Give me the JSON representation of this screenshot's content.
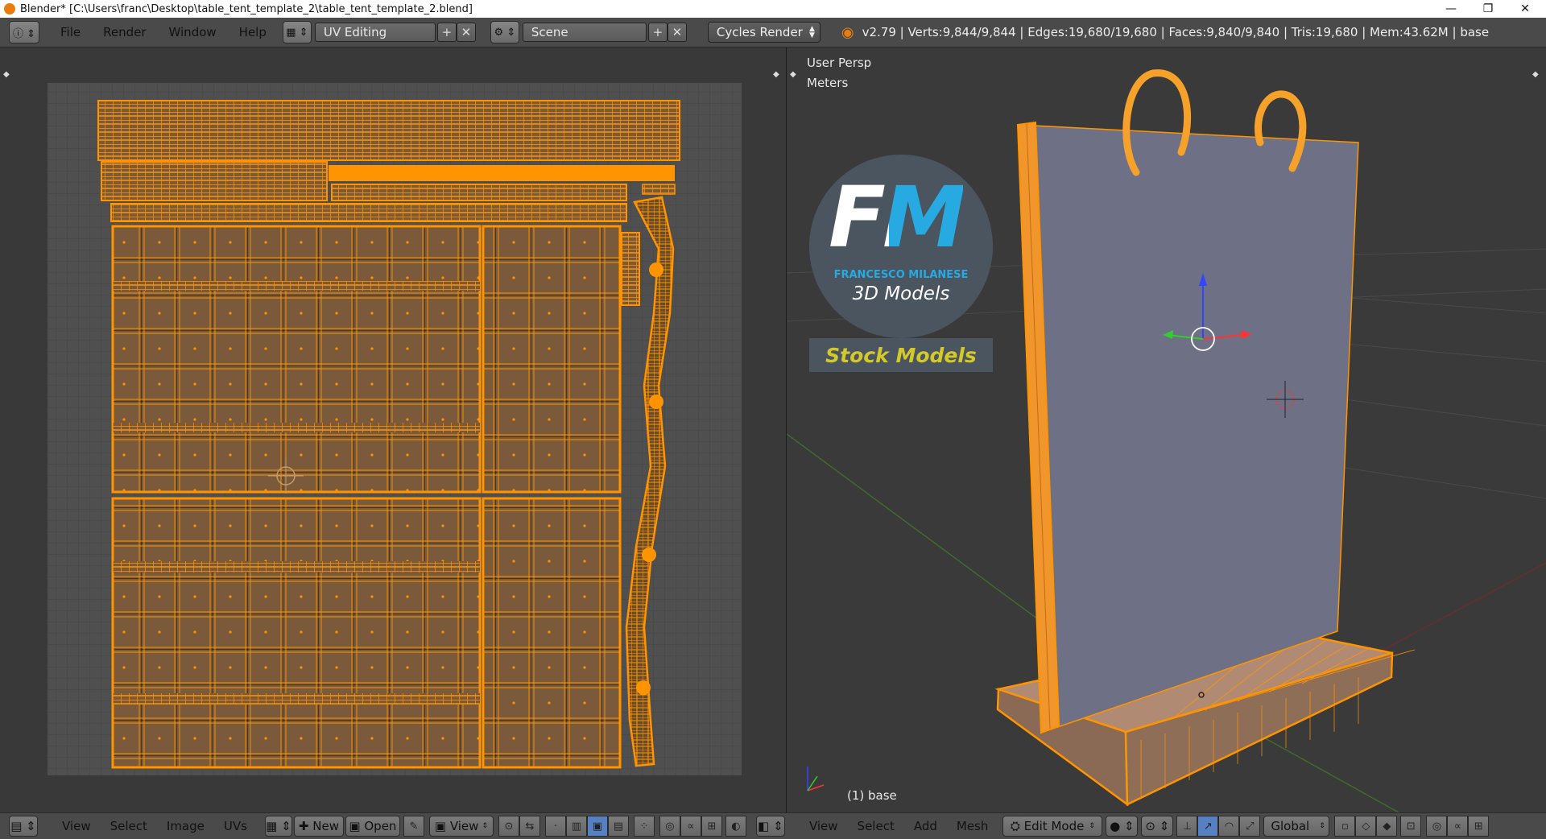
{
  "window": {
    "title": "Blender* [C:\\Users\\franc\\Desktop\\table_tent_template_2\\table_tent_template_2.blend]",
    "minimize": "—",
    "restore": "❐",
    "close": "✕"
  },
  "topbar": {
    "menus": [
      "File",
      "Render",
      "Window",
      "Help"
    ],
    "layout": "UV Editing",
    "scene": "Scene",
    "engine": "Cycles Render",
    "stats": "v2.79 | Verts:9,844/9,844 | Edges:19,680/19,680 | Faces:9,840/9,840 | Tris:19,680 | Mem:43.62M | base"
  },
  "viewport": {
    "view_name": "User Persp",
    "units": "Meters",
    "object_label": "(1) base"
  },
  "logo": {
    "letters": "FM",
    "brand": "FRANCESCO MILANESE",
    "subtitle": "3D Models",
    "banner": "Stock Models"
  },
  "uv_bottom": {
    "menus": [
      "View",
      "Select",
      "Image",
      "UVs"
    ],
    "new_label": "New",
    "open_label": "Open",
    "view_label": "View"
  },
  "vp_bottom": {
    "menus": [
      "View",
      "Select",
      "Add",
      "Mesh"
    ],
    "mode": "Edit Mode",
    "orientation": "Global"
  },
  "colors": {
    "accent": "#ff9400",
    "panel": "#4a4a4a",
    "background": "#393939",
    "mesh_face": "#6e7085"
  }
}
